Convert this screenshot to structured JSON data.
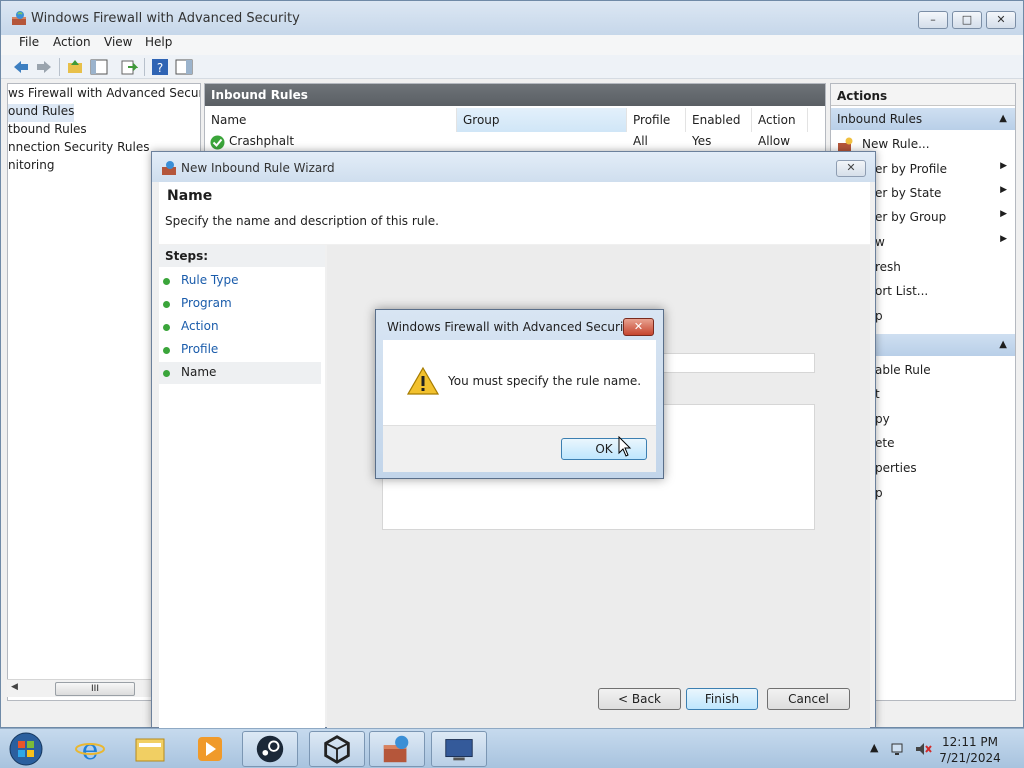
{
  "window": {
    "title": "Windows Firewall with Advanced Security",
    "controls": [
      "–",
      "□",
      "✕"
    ]
  },
  "menu": [
    "File",
    "Action",
    "View",
    "Help"
  ],
  "tree": {
    "items": [
      {
        "label": "ws Firewall with Advanced Security o"
      },
      {
        "label": "ound Rules"
      },
      {
        "label": "tbound Rules"
      },
      {
        "label": "nnection Security Rules"
      },
      {
        "label": "nitoring"
      }
    ],
    "scroll_thumb": "III"
  },
  "center": {
    "header": "Inbound Rules",
    "columns": [
      "Name",
      "Group",
      "Profile",
      "Enabled",
      "Action"
    ],
    "rows": [
      {
        "name": "Crashphalt",
        "group": "",
        "profile": "All",
        "enabled": "Yes",
        "action": "Allow"
      }
    ]
  },
  "actions": {
    "title": "Actions",
    "section1": "Inbound Rules",
    "items1": [
      {
        "label": "New Rule..."
      },
      {
        "label": "er by Profile"
      },
      {
        "label": "er by State"
      },
      {
        "label": "er by Group"
      },
      {
        "label": "w"
      },
      {
        "label": "resh"
      },
      {
        "label": "ort List..."
      },
      {
        "label": "p"
      }
    ],
    "items2": [
      {
        "label": "able Rule"
      },
      {
        "label": "t"
      },
      {
        "label": "py"
      },
      {
        "label": "ete"
      },
      {
        "label": "perties"
      },
      {
        "label": "p"
      }
    ]
  },
  "wizard": {
    "title": "New Inbound Rule Wizard",
    "heading": "Name",
    "description": "Specify the name and description of this rule.",
    "steps_title": "Steps:",
    "steps": [
      "Rule Type",
      "Program",
      "Action",
      "Profile",
      "Name"
    ],
    "buttons": {
      "back": "< Back",
      "finish": "Finish",
      "cancel": "Cancel"
    },
    "close": "✕"
  },
  "dialog": {
    "title": "Windows Firewall with Advanced Security",
    "message": "You must specify the rule name.",
    "ok": "OK",
    "close": "✕"
  },
  "taskbar": {
    "time": "12:11 PM",
    "date": "7/21/2024"
  }
}
